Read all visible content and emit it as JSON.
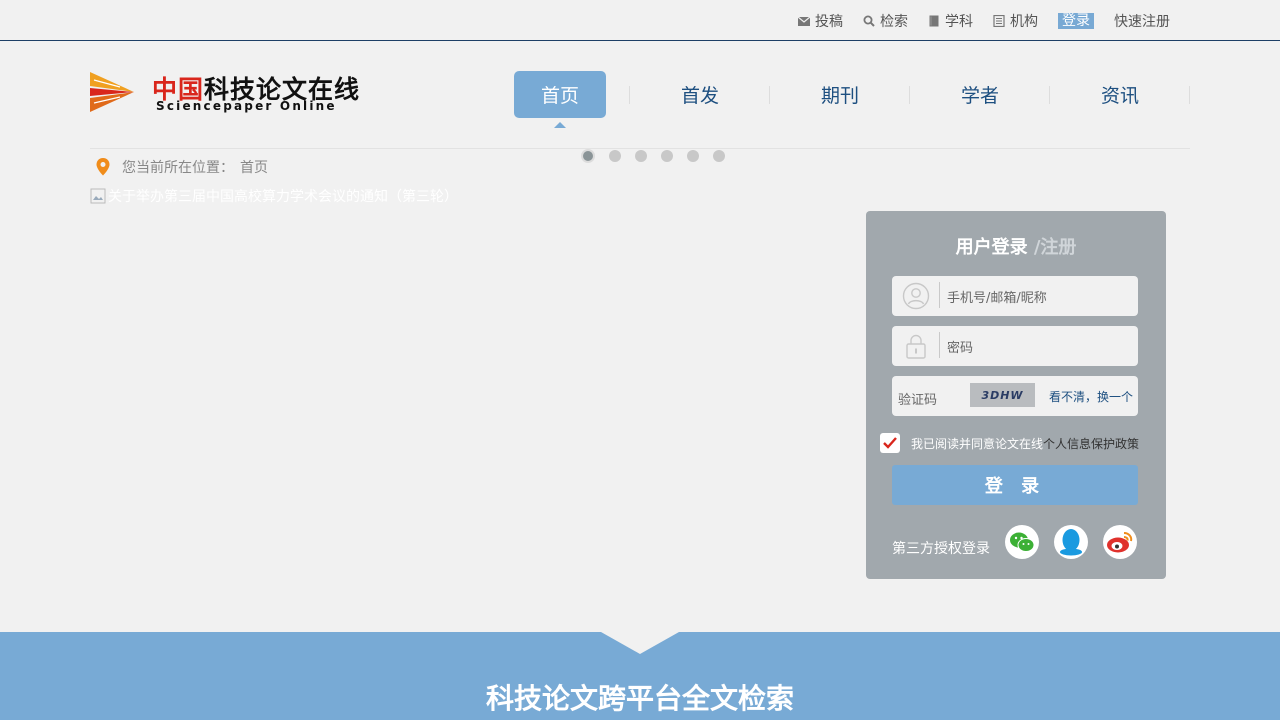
{
  "topbar": {
    "links": [
      {
        "label": "投稿",
        "icon": "mail-icon"
      },
      {
        "label": "检索",
        "icon": "search-icon"
      },
      {
        "label": "学科",
        "icon": "book-icon"
      },
      {
        "label": "机构",
        "icon": "list-icon"
      }
    ],
    "login": "登录",
    "register": "快速注册"
  },
  "logo": {
    "cn_red": "中国",
    "cn_black": "科技论文在线",
    "en": "Sciencepaper Online"
  },
  "nav": {
    "items": [
      "首页",
      "首发",
      "期刊",
      "学者",
      "资讯"
    ],
    "active": "首页"
  },
  "breadcrumb": {
    "label": "您当前所在位置：",
    "current": "首页"
  },
  "carousel": {
    "alt_text": "关于举办第三届中国高校算力学术会议的通知（第三轮）",
    "dots": 6,
    "active_dot": 1
  },
  "login_panel": {
    "title": "用户登录",
    "register": " /注册",
    "username_placeholder": "手机号/邮箱/昵称",
    "password_placeholder": "密码",
    "captcha_label": "验证码",
    "captcha_text": "3DHW",
    "captcha_refresh": "看不清，换一个",
    "agree_text": "我已阅读并同意论文在线",
    "agree_policy": "个人信息保护政策",
    "agree_checked": true,
    "login_button": "登 录",
    "third_party_label": "第三方授权登录",
    "social": [
      "wechat-icon",
      "qq-icon",
      "weibo-icon"
    ]
  },
  "bottom": {
    "title": "科技论文跨平台全文检索"
  },
  "colors": {
    "accent": "#78aad5",
    "nav_text": "#1d4f80",
    "panel": "#a1a8ad",
    "logo_red": "#d9261c"
  }
}
